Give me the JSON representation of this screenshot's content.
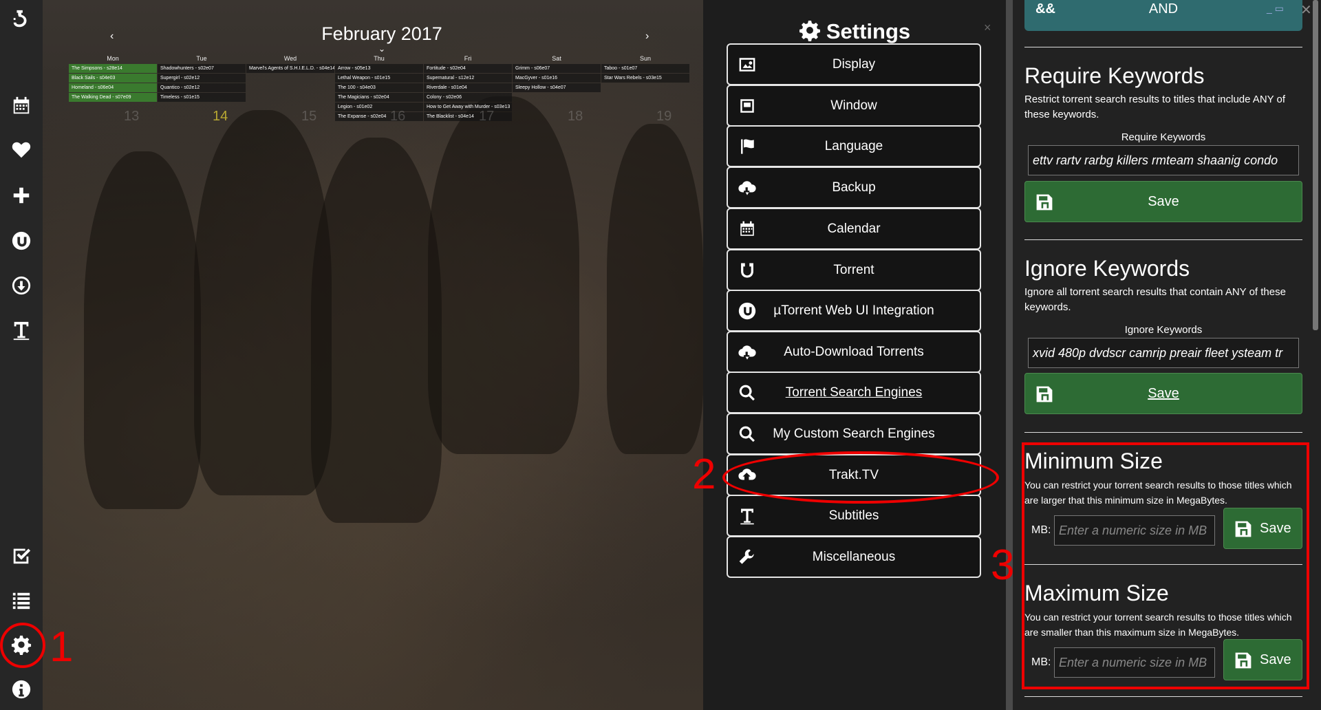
{
  "sidebar": {
    "items": [
      {
        "name": "logo-icon",
        "icon": "app-logo"
      },
      {
        "name": "calendar-icon",
        "icon": "calendar"
      },
      {
        "name": "favorites-icon",
        "icon": "heart"
      },
      {
        "name": "add-icon",
        "icon": "plus"
      },
      {
        "name": "utorrent-icon",
        "icon": "utorrent"
      },
      {
        "name": "download-icon",
        "icon": "download"
      },
      {
        "name": "subtitles-icon",
        "icon": "text"
      },
      {
        "name": "watchlist-icon",
        "icon": "checkbox"
      },
      {
        "name": "list-icon",
        "icon": "list"
      },
      {
        "name": "settings-icon",
        "icon": "gear"
      },
      {
        "name": "info-icon",
        "icon": "info"
      }
    ]
  },
  "calendar": {
    "title": "February 2017",
    "days": [
      "Mon",
      "Tue",
      "Wed",
      "Thu",
      "Fri",
      "Sat",
      "Sun"
    ],
    "day_numbers": [
      "13",
      "14",
      "15",
      "16",
      "17",
      "18",
      "19"
    ],
    "events": [
      [
        "The Simpsons - s28e14",
        "Black Sails - s04e03",
        "Homeland - s06e04",
        "The Walking Dead - s07e09"
      ],
      [
        "Shadowhunters - s02e07",
        "Supergirl - s02e12",
        "Quantico - s02e12",
        "Timeless - s01e15"
      ],
      [
        "Marvel's Agents of S.H.I.E.L.D. - s04e14"
      ],
      [
        "Arrow - s05e13",
        "Lethal Weapon - s01e15",
        "The 100 - s04e03",
        "The Magicians - s02e04",
        "Legion - s01e02",
        "The Expanse - s02e04"
      ],
      [
        "Fortitude - s02e04",
        "Supernatural - s12e12",
        "Riverdale - s01e04",
        "Colony - s02e06",
        "How to Get Away with Murder - s03e13",
        "The Blacklist - s04e14"
      ],
      [
        "Grimm - s06e07",
        "MacGyver - s01e16",
        "Sleepy Hollow - s04e07"
      ],
      [
        "Taboo - s01e07",
        "Star Wars Rebels - s03e15"
      ]
    ]
  },
  "settings": {
    "title": "Settings",
    "close": "×",
    "buttons": [
      {
        "label": "Display",
        "icon": "image"
      },
      {
        "label": "Window",
        "icon": "window"
      },
      {
        "label": "Language",
        "icon": "flag"
      },
      {
        "label": "Backup",
        "icon": "cloud-download"
      },
      {
        "label": "Calendar",
        "icon": "calendar"
      },
      {
        "label": "Torrent",
        "icon": "magnet"
      },
      {
        "label": "µTorrent Web UI Integration",
        "icon": "utorrent"
      },
      {
        "label": "Auto-Download Torrents",
        "icon": "cloud-download"
      },
      {
        "label": "Torrent Search Engines",
        "icon": "search"
      },
      {
        "label": "My Custom Search Engines",
        "icon": "search"
      },
      {
        "label": "Trakt.TV",
        "icon": "cloud-upload"
      },
      {
        "label": "Subtitles",
        "icon": "text"
      },
      {
        "label": "Miscellaneous",
        "icon": "wrench"
      }
    ]
  },
  "filters": {
    "and_bar": {
      "left": "&&",
      "center": "AND"
    },
    "require": {
      "title": "Require Keywords",
      "desc": "Restrict torrent search results to titles that include ANY of these keywords.",
      "field_label": "Require Keywords",
      "value": "ettv rartv rarbg killers rmteam shaanig condo",
      "save": "Save"
    },
    "ignore": {
      "title": "Ignore Keywords",
      "desc": "Ignore all torrent search results that contain ANY of these keywords.",
      "field_label": "Ignore Keywords",
      "value": "xvid 480p dvdscr camrip preair fleet ysteam tr",
      "save": "Save"
    },
    "min_size": {
      "title": "Minimum Size",
      "desc": "You can restrict your torrent search results to those titles which are larger that this minimum size in MegaBytes.",
      "mb_label": "MB:",
      "placeholder": "Enter a numeric size in MB",
      "save": "Save"
    },
    "max_size": {
      "title": "Maximum Size",
      "desc": "You can restrict your torrent search results to those titles which are smaller than this maximum size in MegaBytes.",
      "mb_label": "MB:",
      "placeholder": "Enter a numeric size in MB",
      "save": "Save"
    }
  },
  "annotations": {
    "one": "1",
    "two": "2",
    "three": "3"
  },
  "colors": {
    "accent_green": "#2d6b34",
    "and_bar": "#2f6b6f",
    "annotation": "#e00000"
  }
}
